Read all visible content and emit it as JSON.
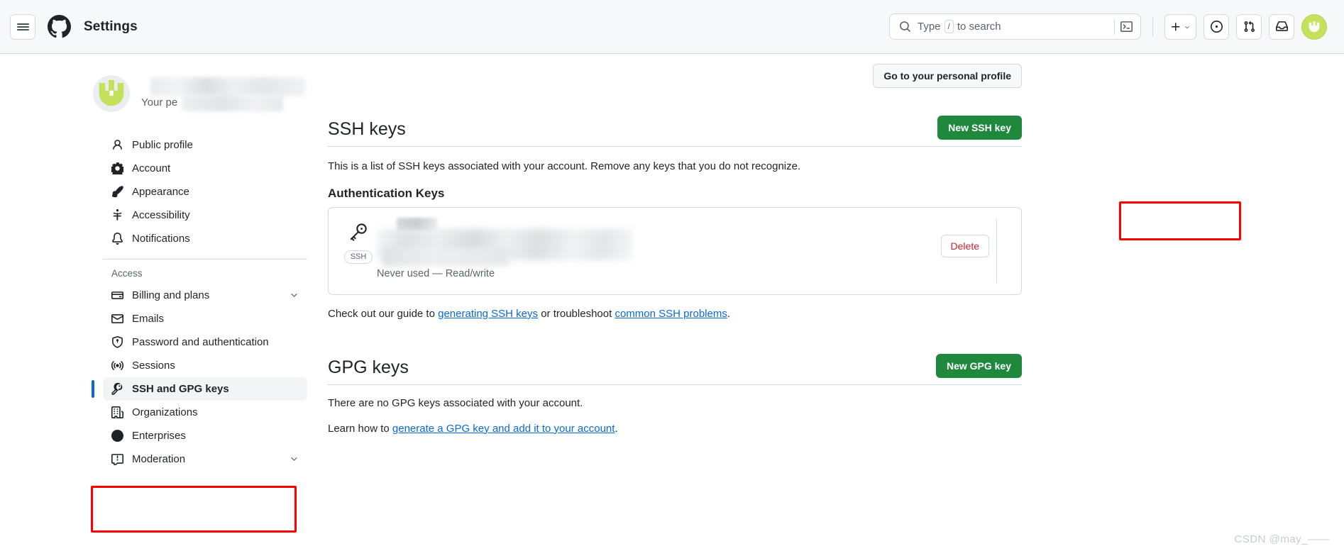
{
  "header": {
    "title": "Settings",
    "menu_label": "Open menu",
    "logo_name": "github-logo",
    "search": {
      "placeholder_prefix": "Type",
      "slash_key": "/",
      "placeholder_suffix": "to search",
      "command_palette_label": "Command palette"
    },
    "actions": [
      {
        "name": "create-new-button",
        "label": "+"
      },
      {
        "name": "issues-button",
        "label": "Issues"
      },
      {
        "name": "pull-requests-button",
        "label": "Pull requests"
      },
      {
        "name": "inbox-button",
        "label": "Notifications inbox"
      },
      {
        "name": "user-avatar-button",
        "label": "Open user menu"
      }
    ]
  },
  "profile": {
    "name_redacted": "",
    "subtitle": "Your pe",
    "subtitle_full": "Your personal account",
    "go_to_profile_label": "Go to your personal profile"
  },
  "sidebar": {
    "items": [
      {
        "label": "Public profile",
        "icon": "person-icon",
        "selected": false,
        "expandable": false
      },
      {
        "label": "Account",
        "icon": "gear-icon",
        "selected": false,
        "expandable": false
      },
      {
        "label": "Appearance",
        "icon": "paintbrush-icon",
        "selected": false,
        "expandable": false
      },
      {
        "label": "Accessibility",
        "icon": "accessibility-icon",
        "selected": false,
        "expandable": false
      },
      {
        "label": "Notifications",
        "icon": "bell-icon",
        "selected": false,
        "expandable": false
      }
    ],
    "group_title": "Access",
    "access_items": [
      {
        "label": "Billing and plans",
        "icon": "credit-card-icon",
        "selected": false,
        "expandable": true
      },
      {
        "label": "Emails",
        "icon": "mail-icon",
        "selected": false,
        "expandable": false
      },
      {
        "label": "Password and authentication",
        "icon": "shield-lock-icon",
        "selected": false,
        "expandable": false
      },
      {
        "label": "Sessions",
        "icon": "broadcast-icon",
        "selected": false,
        "expandable": false
      },
      {
        "label": "SSH and GPG keys",
        "icon": "key-icon",
        "selected": true,
        "expandable": false
      },
      {
        "label": "Organizations",
        "icon": "organization-icon",
        "selected": false,
        "expandable": false
      },
      {
        "label": "Enterprises",
        "icon": "globe-icon",
        "selected": false,
        "expandable": false
      },
      {
        "label": "Moderation",
        "icon": "report-icon",
        "selected": false,
        "expandable": true
      }
    ]
  },
  "ssh_section": {
    "title": "SSH keys",
    "new_key_button": "New SSH key",
    "description": "This is a list of SSH keys associated with your account. Remove any keys that you do not recognize.",
    "auth_keys_heading": "Authentication Keys",
    "key": {
      "badge": "SSH",
      "title_redacted": "",
      "fingerprint_redacted": "",
      "added_redacted": "",
      "usage": "Never used — Read/write",
      "delete_button": "Delete"
    },
    "guide_prefix": "Check out our guide to",
    "guide_link_1": "generating SSH keys",
    "guide_middle": "or troubleshoot",
    "guide_link_2": "common SSH problems",
    "guide_suffix": "."
  },
  "gpg_section": {
    "title": "GPG keys",
    "new_key_button": "New GPG key",
    "empty_message": "There are no GPG keys associated with your account.",
    "learn_prefix": "Learn how to",
    "learn_link": "generate a GPG key and add it to your account",
    "learn_suffix": "."
  },
  "annotations": {
    "sidebar_highlight_target": "SSH and GPG keys",
    "button_highlight_target": "New SSH key",
    "color": "#ff0000"
  },
  "watermark": "CSDN @may_——",
  "colors": {
    "primary_button": "#1f883d",
    "link": "#0969da",
    "danger": "#cf222e",
    "selected_accent": "#0969da",
    "avatar": "#c5e05a"
  }
}
